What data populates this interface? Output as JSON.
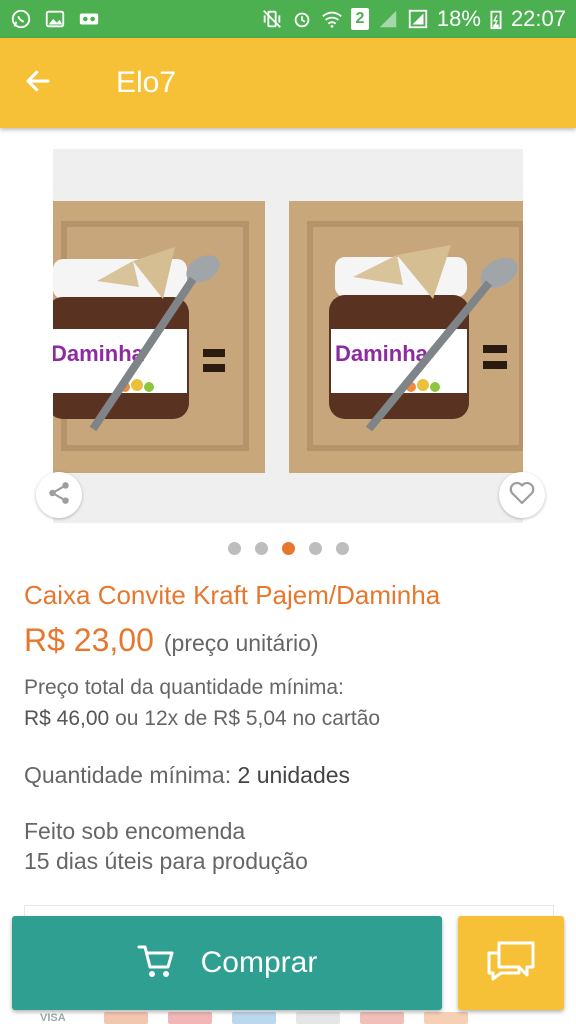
{
  "status_bar": {
    "battery": "18%",
    "time": "22:07",
    "sim_badge": "2",
    "left_icons": [
      "whatsapp-icon",
      "image-icon",
      "voicemail-icon"
    ],
    "right_icons": [
      "vibrate-icon",
      "alarm-icon",
      "wifi-icon",
      "signal-icon",
      "battery-icon"
    ]
  },
  "header": {
    "title": "Elo7",
    "back_icon": "arrow-left-icon"
  },
  "gallery": {
    "current_index": 3,
    "total": 5,
    "box_text_brand": "Daminha"
  },
  "product": {
    "title": "Caixa Convite Kraft Pajem/Daminha",
    "price": "R$ 23,00",
    "price_note": "(preço unitário)",
    "total_label": "Preço total da quantidade mínima:",
    "total_price": "R$ 46,00",
    "installments": "ou 12x de R$ 5,04 no cartão",
    "min_qty_label": "Quantidade mínima:",
    "min_qty_value": "2 unidades",
    "made_to_order": "Feito sob encomenda",
    "production_days": "15 dias úteis para produção"
  },
  "actions": {
    "buy_label": "Comprar",
    "buy_icon": "cart-icon",
    "chat_icon": "chat-icon"
  },
  "payment": {
    "visa_label": "VISA"
  },
  "colors": {
    "status_bar": "#4caf50",
    "header": "#f6c137",
    "accent_orange": "#e8772e",
    "buy_button": "#2f9f92"
  }
}
